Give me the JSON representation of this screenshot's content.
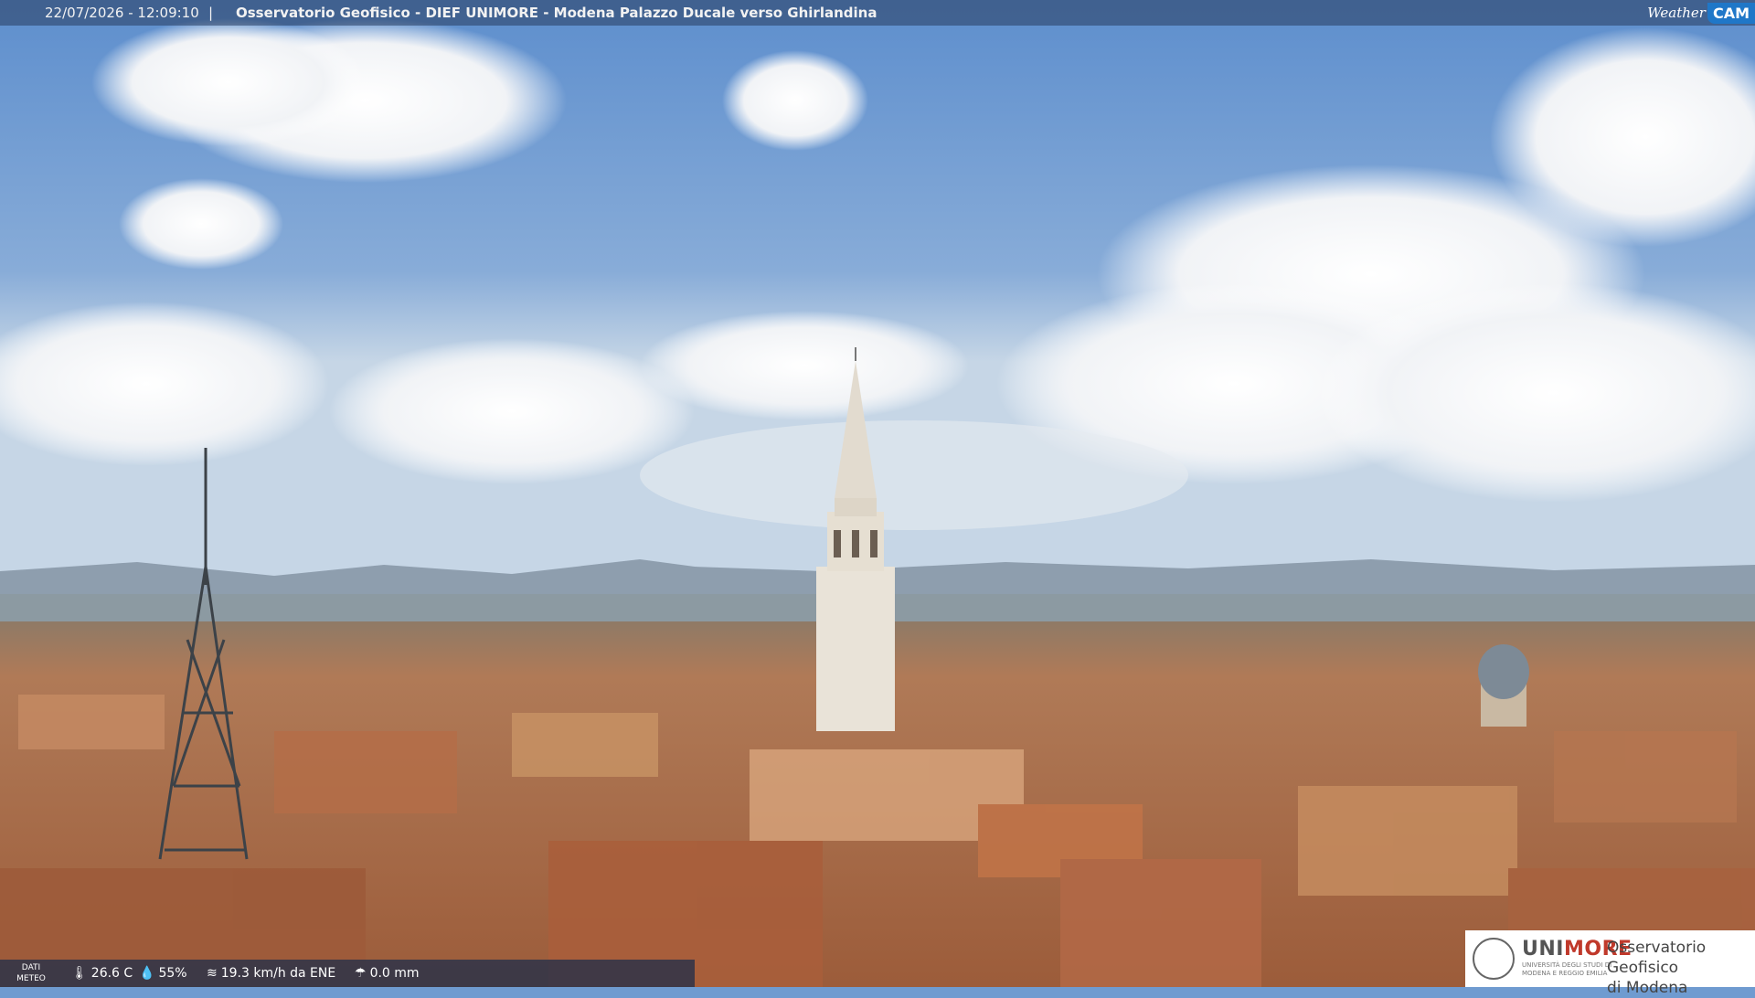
{
  "overlay_top": {
    "timestamp": "22/07/2026 - 12:09:10",
    "separator": "|",
    "title": "Osservatorio Geofisico - DIEF UNIMORE - Modena Palazzo Ducale verso Ghirlandina"
  },
  "brand": {
    "weather": "Weather",
    "cam": "CAM"
  },
  "weather_bar": {
    "label_line1": "DATI",
    "label_line2": "METEO",
    "temperature": "26.6 C",
    "humidity": "55%",
    "wind": "19.3 km/h da ENE",
    "rain": "0.0 mm"
  },
  "logo": {
    "uni_prefix": "UNI",
    "uni_suffix": "MORE",
    "uni_subtitle": "UNIVERSITÀ DEGLI STUDI DI MODENA E REGGIO EMILIA",
    "observatory_line1": "Osservatorio Geofisico",
    "observatory_line2": "di Modena"
  },
  "colors": {
    "sky_top": "#5f90cf",
    "sky_horizon": "#c6d6e6",
    "roofs": "#b5734c",
    "tower": "#e9e3d8",
    "unimore_red": "#c0392b"
  }
}
